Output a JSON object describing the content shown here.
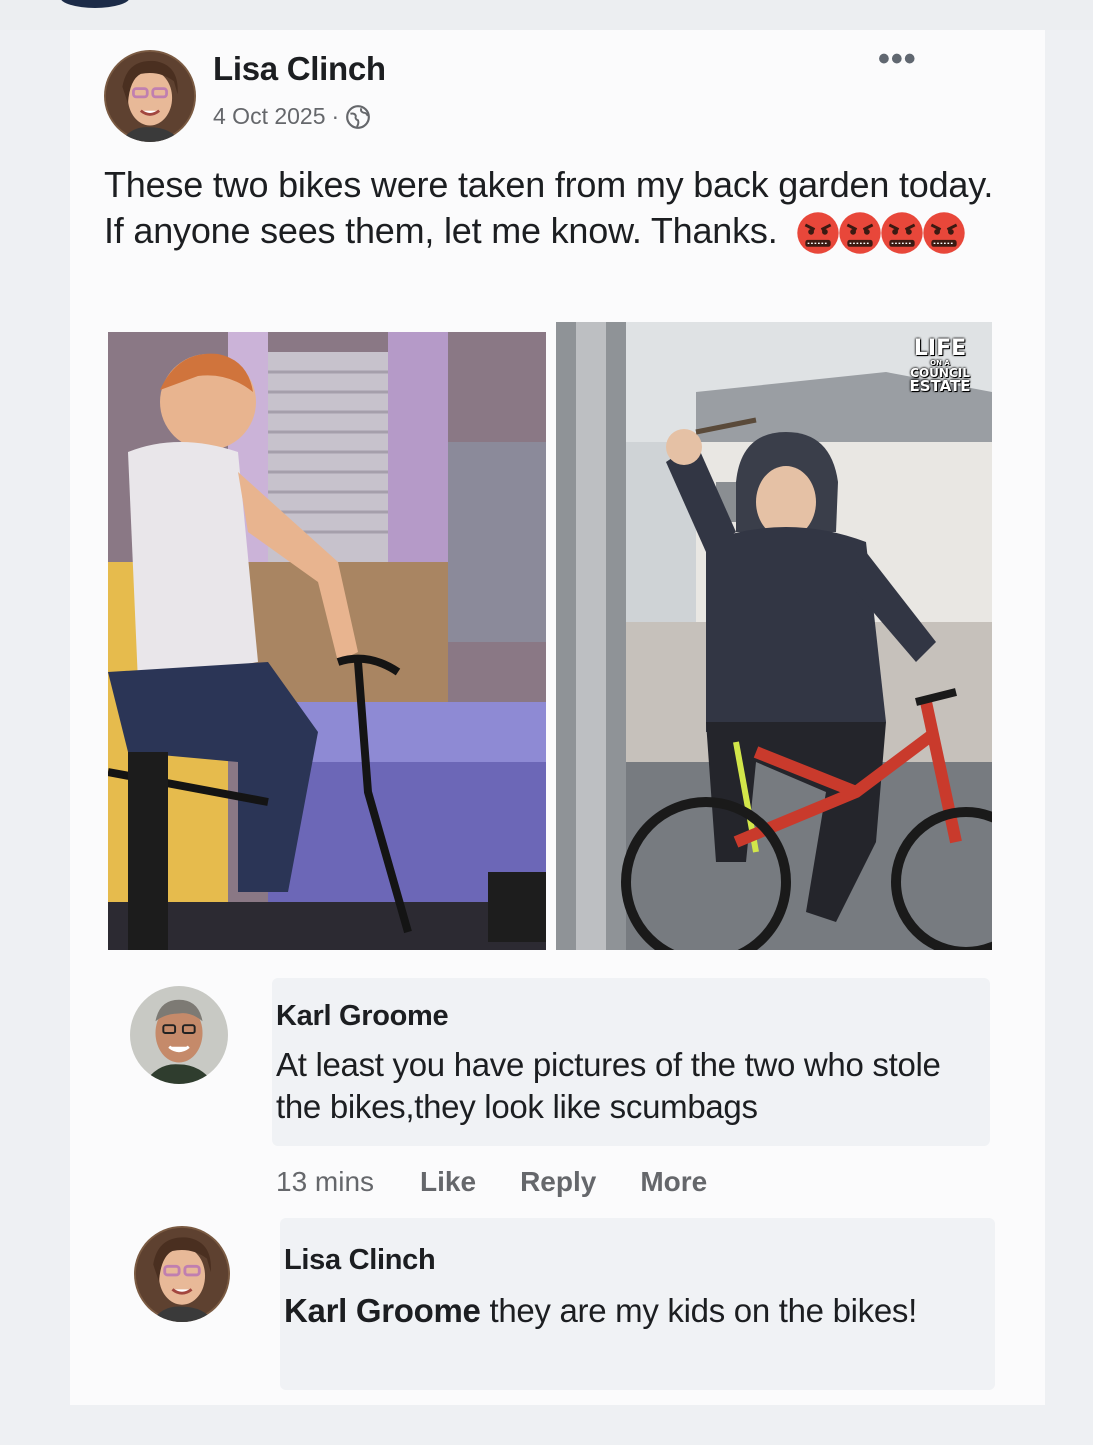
{
  "post": {
    "author": "Lisa Clinch",
    "date": "4 Oct 2025",
    "separator": "·",
    "privacy_icon": "globe-icon",
    "more_icon": "more-options-icon",
    "more_label": "•••",
    "text": "These two bikes were taken from my back garden today. If anyone sees them, let me know. Thanks.",
    "emojis": [
      "angry-face-emoji",
      "angry-face-emoji",
      "angry-face-emoji",
      "angry-face-emoji"
    ],
    "watermark": {
      "line1": "LIFE",
      "line2": "ON A",
      "line3": "COUNCIL",
      "line4": "ESTATE"
    }
  },
  "comments": [
    {
      "author": "Karl Groome",
      "text": "At least you have pictures of the two who stole the bikes,they look like scumbags",
      "timestamp": "13 mins",
      "like_label": "Like",
      "reply_label": "Reply",
      "more_label": "More"
    },
    {
      "author": "Lisa Clinch",
      "mention": "Karl Groome",
      "text": " they are my kids on the bikes!"
    }
  ],
  "colors": {
    "text": "#1c1e21",
    "secondary": "#65676b",
    "bubble": "#f0f2f5",
    "angry_emoji": "#e8473a"
  }
}
